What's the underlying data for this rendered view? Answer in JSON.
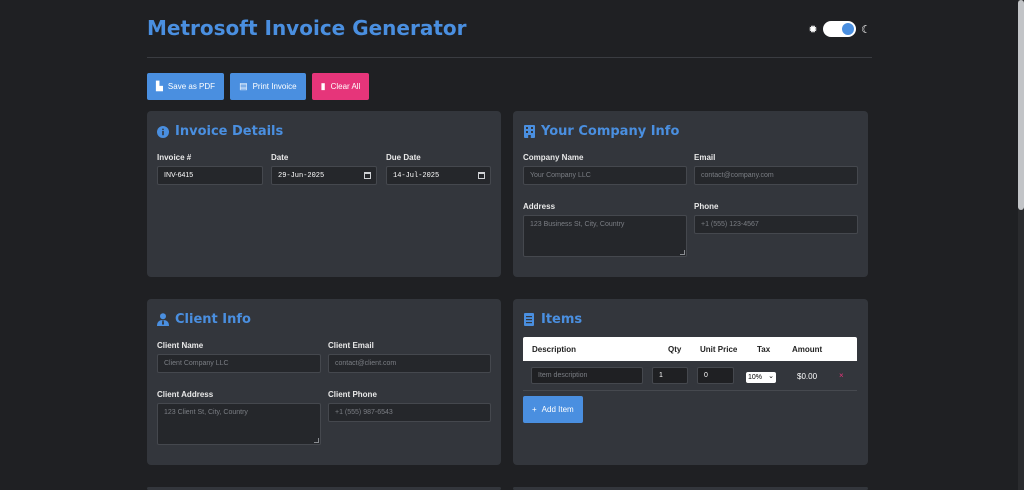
{
  "header": {
    "title": "Metrosoft Invoice Generator"
  },
  "theme": {
    "sun_icon": "sun-icon",
    "moon_icon": "moon-icon",
    "dark_mode": true
  },
  "toolbar": {
    "save_label": "Save as PDF",
    "print_label": "Print Invoice",
    "clear_label": "Clear All"
  },
  "invoice_details": {
    "title": "Invoice Details",
    "invoice_label": "Invoice #",
    "invoice_value": "INV-6415",
    "date_label": "Date",
    "date_value": "29-Jun-2025",
    "due_label": "Due Date",
    "due_value": "14-Jul-2025"
  },
  "company": {
    "title": "Your Company Info",
    "name_label": "Company Name",
    "name_placeholder": "Your Company LLC",
    "email_label": "Email",
    "email_placeholder": "contact@company.com",
    "address_label": "Address",
    "address_placeholder": "123 Business St, City, Country",
    "phone_label": "Phone",
    "phone_placeholder": "+1 (555) 123-4567"
  },
  "client": {
    "title": "Client Info",
    "name_label": "Client Name",
    "name_placeholder": "Client Company LLC",
    "email_label": "Client Email",
    "email_placeholder": "contact@client.com",
    "address_label": "Client Address",
    "address_placeholder": "123 Client St, City, Country",
    "phone_label": "Client Phone",
    "phone_placeholder": "+1 (555) 987-6543"
  },
  "items": {
    "title": "Items",
    "columns": [
      "Description",
      "Qty",
      "Unit Price",
      "Tax",
      "Amount"
    ],
    "rows": [
      {
        "description_placeholder": "Item description",
        "qty": "1",
        "unit_price": "0",
        "tax": "10%",
        "amount": "$0.00"
      }
    ],
    "remove_symbol": "×",
    "add_label": "Add Item"
  },
  "colors": {
    "accent": "#4a8fe0",
    "danger": "#e6357a",
    "background": "#1f2023",
    "card": "#33363c"
  }
}
